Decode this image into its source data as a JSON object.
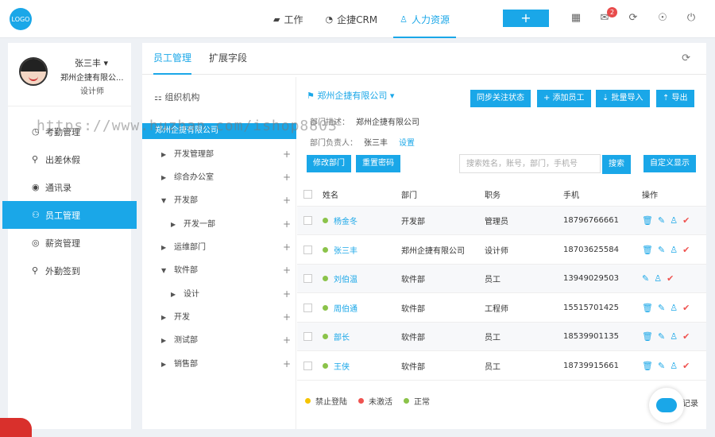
{
  "topbar": {
    "logo": "LOGO",
    "nav": [
      {
        "label": "工作",
        "icon": "briefcase-icon",
        "glyph": "▰"
      },
      {
        "label": "企捷CRM",
        "icon": "pie-chart-icon",
        "glyph": "◔"
      },
      {
        "label": "人力资源",
        "icon": "people-icon",
        "glyph": "♙"
      }
    ],
    "plus_label": "+",
    "mail_badge": "2"
  },
  "sidebar": {
    "user_name": "张三丰 ▾",
    "company": "郑州企捷有限公...",
    "role": "设计师",
    "items": [
      {
        "label": "考勤管理",
        "icon": "clock-icon",
        "glyph": "◷"
      },
      {
        "label": "出差休假",
        "icon": "location-icon",
        "glyph": "⚲"
      },
      {
        "label": "通讯录",
        "icon": "contacts-icon",
        "glyph": "◉"
      },
      {
        "label": "员工管理",
        "icon": "staff-icon",
        "glyph": "⚇"
      },
      {
        "label": "薪资管理",
        "icon": "salary-icon",
        "glyph": "◎"
      },
      {
        "label": "外勤签到",
        "icon": "pin-icon",
        "glyph": "⚲"
      }
    ]
  },
  "tabs": [
    "员工管理",
    "扩展字段"
  ],
  "tree": {
    "title": "组织机构",
    "root": "郑州企捷有限公司",
    "nodes": [
      {
        "label": "开发管理部",
        "arrow": "▶"
      },
      {
        "label": "综合办公室",
        "arrow": "▶"
      },
      {
        "label": "开发部",
        "arrow": "▼"
      },
      {
        "label": "开发一部",
        "arrow": "▶"
      },
      {
        "label": "运维部门",
        "arrow": "▶"
      },
      {
        "label": "软件部",
        "arrow": "▼"
      },
      {
        "label": "设计",
        "arrow": "▶"
      },
      {
        "label": "开发",
        "arrow": "▶"
      },
      {
        "label": "测试部",
        "arrow": "▶"
      },
      {
        "label": "销售部",
        "arrow": "▶"
      }
    ]
  },
  "content": {
    "company_title": "郑州企捷有限公司 ▾",
    "buttons": {
      "sync": "同步关注状态",
      "add": "+ 添加员工",
      "import": "⇣ 批量导入",
      "export": "⇡ 导出",
      "edit_dept": "修改部门",
      "reset_pwd": "重置密码",
      "search": "搜索",
      "custom": "自定义显示"
    },
    "dept_desc_label": "部门描述：",
    "dept_desc_value": "郑州企捷有限公司",
    "dept_head_label": "部门负责人：",
    "dept_head_value": "张三丰",
    "dept_head_link": "设置",
    "search_placeholder": "搜索姓名，账号，部门，手机号"
  },
  "table": {
    "headers": [
      "姓名",
      "部门",
      "职务",
      "手机",
      "操作"
    ],
    "rows": [
      {
        "name": "杨金冬",
        "dept": "开发部",
        "title": "管理员",
        "phone": "18796766661",
        "status_color": "#8bc34a",
        "actions": 4
      },
      {
        "name": "张三丰",
        "dept": "郑州企捷有限公司",
        "title": "设计师",
        "phone": "18703625584",
        "status_color": "#8bc34a",
        "actions": 4
      },
      {
        "name": "刘伯温",
        "dept": "软件部",
        "title": "员工",
        "phone": "13949029503",
        "status_color": "#8bc34a",
        "actions": 3
      },
      {
        "name": "周伯通",
        "dept": "软件部",
        "title": "工程师",
        "phone": "15515701425",
        "status_color": "#8bc34a",
        "actions": 4
      },
      {
        "name": "部长",
        "dept": "软件部",
        "title": "员工",
        "phone": "18539901135",
        "status_color": "#8bc34a",
        "actions": 4
      },
      {
        "name": "王侠",
        "dept": "软件部",
        "title": "员工",
        "phone": "18739915661",
        "status_color": "#8bc34a",
        "actions": 4
      }
    ]
  },
  "legend": [
    {
      "label": "禁止登陆",
      "color": "#f5c400"
    },
    {
      "label": "未激活",
      "color": "#ef5350"
    },
    {
      "label": "正常",
      "color": "#8bc34a"
    }
  ],
  "records_label": "记录",
  "watermark": "https://www.huzhan.com/ishop8803",
  "colors": {
    "accent": "#1aa7e8",
    "danger": "#ef5350"
  }
}
